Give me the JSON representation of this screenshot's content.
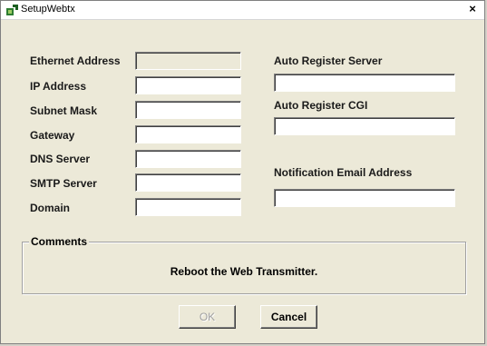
{
  "window": {
    "title": "SetupWebtx",
    "close_glyph": "×",
    "icon": "app-icon"
  },
  "left_fields": [
    {
      "label": "Ethernet Address",
      "value": "",
      "disabled": true
    },
    {
      "label": "IP Address",
      "value": ""
    },
    {
      "label": "Subnet Mask",
      "value": ""
    },
    {
      "label": "Gateway",
      "value": ""
    },
    {
      "label": "DNS Server",
      "value": ""
    },
    {
      "label": "SMTP Server",
      "value": ""
    },
    {
      "label": "Domain",
      "value": ""
    }
  ],
  "right_fields": {
    "auto_register_server": {
      "label": "Auto Register Server",
      "value": ""
    },
    "auto_register_cgi": {
      "label": "Auto Register CGI",
      "value": ""
    },
    "notification_email": {
      "label": "Notification Email Address",
      "value": ""
    }
  },
  "comments": {
    "legend": "Comments",
    "text": "Reboot the Web Transmitter."
  },
  "buttons": {
    "ok_label": "OK",
    "cancel_label": "Cancel"
  }
}
